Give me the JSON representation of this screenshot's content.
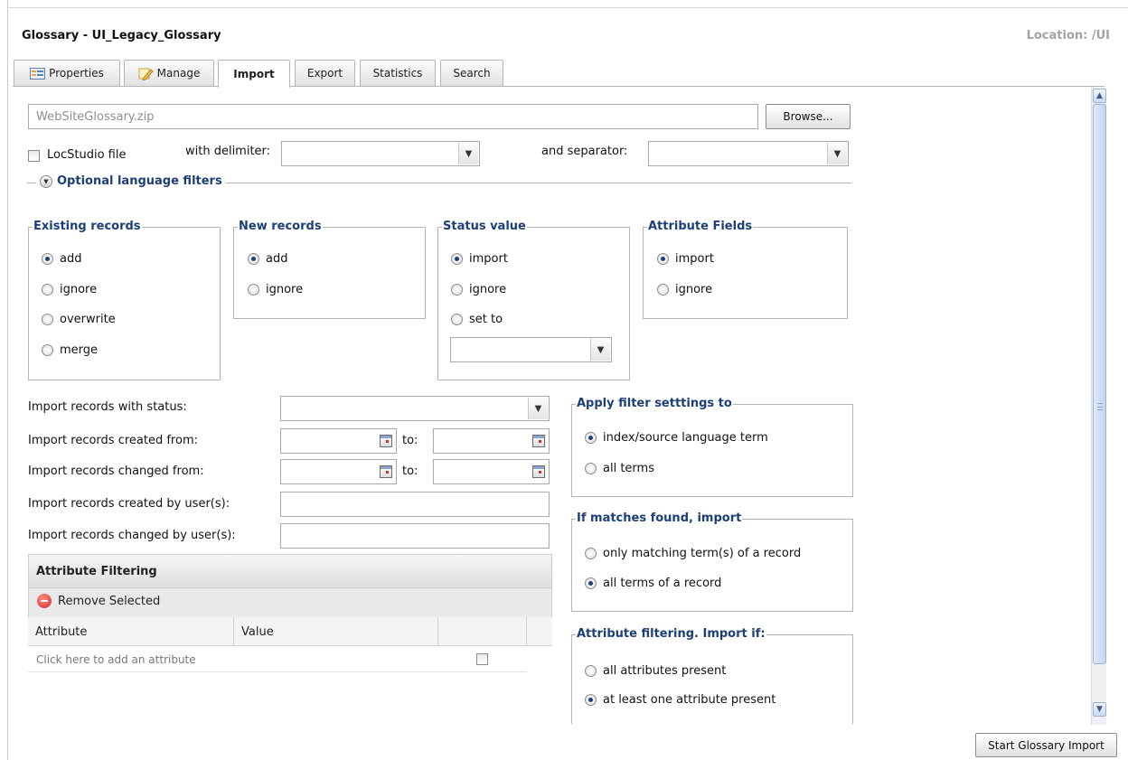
{
  "header": {
    "title": "Glossary - UI_Legacy_Glossary",
    "location": "Location: /UI"
  },
  "tabs": [
    {
      "label": "Properties",
      "icon": "properties-icon",
      "active": false
    },
    {
      "label": "Manage",
      "icon": "pencil-icon",
      "active": false
    },
    {
      "label": "Import",
      "active": true
    },
    {
      "label": "Export",
      "active": false
    },
    {
      "label": "Statistics",
      "active": false
    },
    {
      "label": "Search",
      "active": false
    }
  ],
  "file": {
    "placeholder": "WebSiteGlossary.zip",
    "browse_label": "Browse..."
  },
  "locstudio": {
    "checkbox_label": "LocStudio file",
    "delimiter_label": "with delimiter:",
    "separator_label": "and separator:"
  },
  "optional_filters": {
    "label": "Optional language filters"
  },
  "existing_records": {
    "legend": "Existing records",
    "options": [
      "add",
      "ignore",
      "overwrite",
      "merge"
    ],
    "selected": "add"
  },
  "new_records": {
    "legend": "New records",
    "options": [
      "add",
      "ignore"
    ],
    "selected": "add"
  },
  "status_value": {
    "legend": "Status value",
    "options": [
      "import",
      "ignore",
      "set to"
    ],
    "selected": "import"
  },
  "attribute_fields": {
    "legend": "Attribute Fields",
    "options": [
      "import",
      "ignore"
    ],
    "selected": "import"
  },
  "import_filters": {
    "with_status_label": "Import records with status:",
    "created_from_label": "Import records created from:",
    "changed_from_label": "Import records changed from:",
    "to_label": "to:",
    "created_by_label": "Import records created by user(s):",
    "changed_by_label": "Import records changed by user(s):"
  },
  "apply_filter": {
    "legend": "Apply filter setttings to",
    "options": [
      "index/source language term",
      "all terms"
    ],
    "selected": "index/source language term"
  },
  "matches_found": {
    "legend": "If matches found, import",
    "options": [
      "only matching term(s) of a record",
      "all terms of a record"
    ],
    "selected": "all terms of a record"
  },
  "attribute_filtering_import": {
    "legend": "Attribute filtering. Import if:",
    "options": [
      "all attributes present",
      "at least one attribute present"
    ],
    "selected": "at least one attribute present"
  },
  "attribute_grid": {
    "title": "Attribute Filtering",
    "remove_label": "Remove Selected",
    "columns": [
      "Attribute",
      "Value"
    ],
    "empty_row": "Click here to add an attribute"
  },
  "start_import_label": "Start Glossary Import"
}
